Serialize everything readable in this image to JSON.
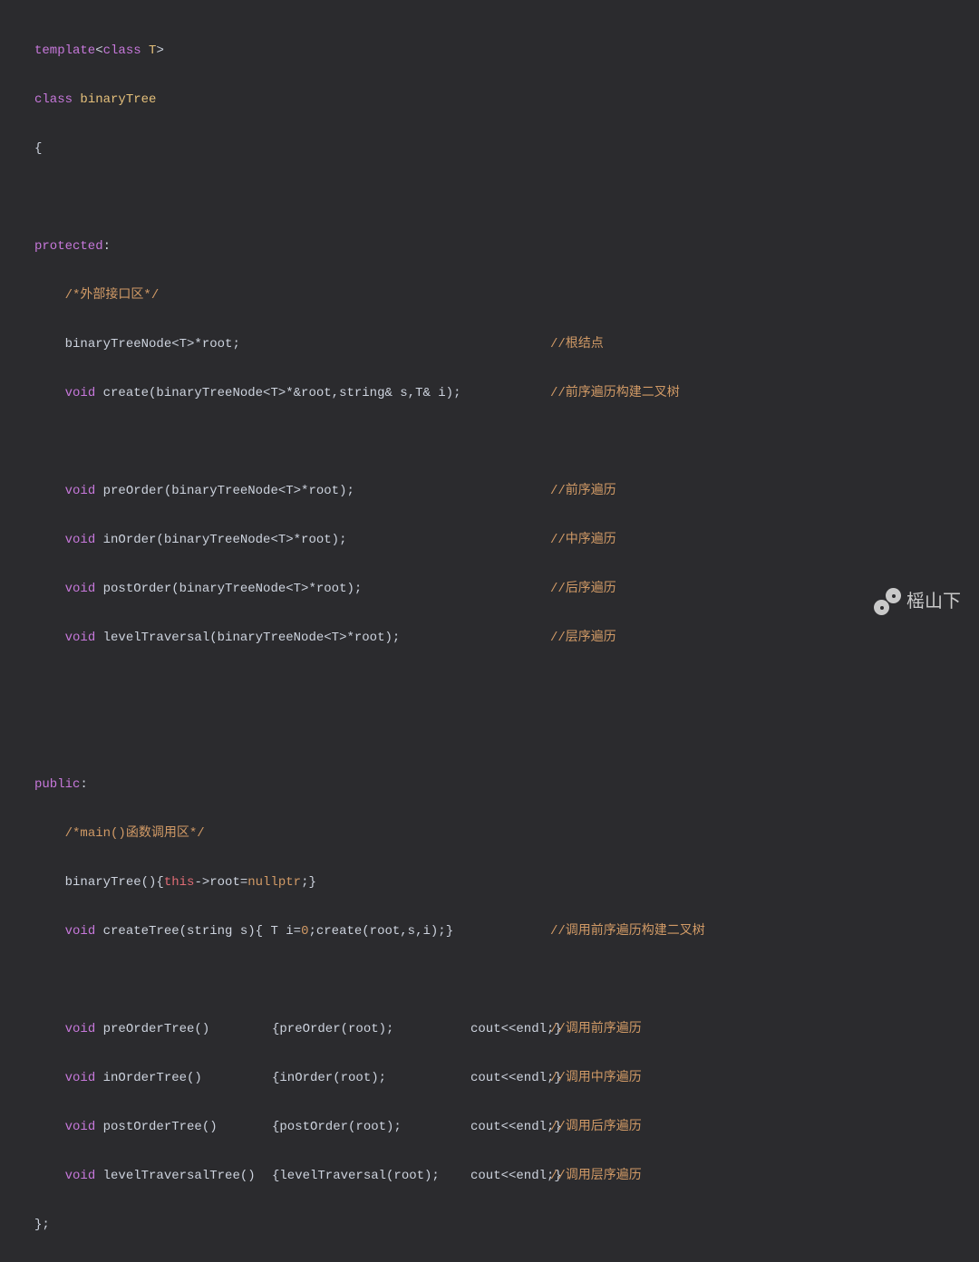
{
  "code": {
    "l1": {
      "kw1": "template",
      "kw2": "class",
      "t": "T",
      "a": "<",
      "b": ">"
    },
    "l2": {
      "kw": "class",
      "name": "binaryTree"
    },
    "l3": {
      "br": "{"
    },
    "l5": {
      "kw": "protected",
      "c": ":"
    },
    "l6": {
      "c": "/*外部接口区*/"
    },
    "l7": {
      "code": "binaryTreeNode<T>*root;",
      "cm": "//根结点"
    },
    "l8": {
      "kw": "void",
      "code": " create(binaryTreeNode<T>*&root,string& s,T& i);",
      "cm": "//前序遍历构建二叉树"
    },
    "l10": {
      "kw": "void",
      "code": " preOrder(binaryTreeNode<T>*root);",
      "cm": "//前序遍历"
    },
    "l11": {
      "kw": "void",
      "code": " inOrder(binaryTreeNode<T>*root);",
      "cm": "//中序遍历"
    },
    "l12": {
      "kw": "void",
      "code": " postOrder(binaryTreeNode<T>*root);",
      "cm": "//后序遍历"
    },
    "l13": {
      "kw": "void",
      "code": " levelTraversal(binaryTreeNode<T>*root);",
      "cm": "//层序遍历"
    },
    "l16": {
      "kw": "public",
      "c": ":"
    },
    "l17": {
      "c": "/*main()函数调用区*/"
    },
    "l18": {
      "p1": "binaryTree(){",
      "this": "this",
      "p2": "->root=",
      "null": "nullptr",
      "p3": ";}"
    },
    "l19": {
      "kw": "void",
      "p1": " createTree(string s){ T i=",
      "num": "0",
      "p2": ";create(root,s,i);}",
      "cm": "//调用前序遍历构建二叉树"
    },
    "l21": {
      "kw": "void",
      "name": " preOrderTree()",
      "body": "{preOrder(root);",
      "tail": "cout<<endl;}",
      "cm": "//调用前序遍历"
    },
    "l22": {
      "kw": "void",
      "name": " inOrderTree()",
      "body": "{inOrder(root);",
      "tail": "cout<<endl;}",
      "cm": "//调用中序遍历"
    },
    "l23": {
      "kw": "void",
      "name": " postOrderTree()",
      "body": "{postOrder(root);",
      "tail": "cout<<endl;}",
      "cm": "//调用后序遍历"
    },
    "l24": {
      "kw": "void",
      "name": " levelTraversalTree()",
      "body": "{levelTraversal(root);",
      "tail": "cout<<endl;}",
      "cm": "//调用层序遍历"
    },
    "l25": {
      "br": "};"
    }
  },
  "columns": {
    "indent1": "    ",
    "indent2": "        ",
    "c1": 607,
    "cname": 296,
    "cbody": 296,
    "ctail": 520
  },
  "watermark": {
    "text": "榣山下"
  }
}
